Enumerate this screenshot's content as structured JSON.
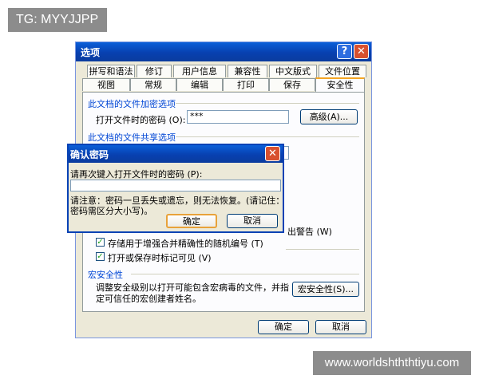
{
  "watermarks": {
    "top": "TG: MYYJJPP",
    "bottom": "www.worldshththtiyu.com"
  },
  "dialog": {
    "title": "选项",
    "help": "?",
    "close": "✕",
    "tabs_row1": [
      "拼写和语法",
      "修订",
      "用户信息",
      "兼容性",
      "中文版式",
      "文件位置"
    ],
    "tabs_row2": [
      "视图",
      "常规",
      "编辑",
      "打印",
      "保存",
      "安全性"
    ],
    "encrypt_section": "此文档的文件加密选项",
    "open_pw_label": "打开文件时的密码 (O):",
    "open_pw_value": "***",
    "advanced_button": "高级(A)...",
    "share_section": "此文档的文件共享选项",
    "warn_tail": "出警告 (W)",
    "check_random": "存储用于增强合并精确性的随机编号 (T)",
    "check_marks": "打开或保存时标记可见 (V)",
    "macro_section": "宏安全性",
    "macro_text_1": "调整安全级别以打开可能包含宏病毒的文件，并指",
    "macro_text_2": "定可信任的宏创建者姓名。",
    "macro_button": "宏安全性(S)...",
    "ok": "确定",
    "cancel": "取消"
  },
  "confirm": {
    "title": "确认密码",
    "close": "✕",
    "prompt": "请再次键入打开文件时的密码 (P):",
    "input_value": "",
    "note_1": "请注意：密码一旦丢失或遗忘，则无法恢复。(请记住：",
    "note_2": "密码需区分大小写)。",
    "ok": "确定",
    "cancel": "取消"
  },
  "colors": {
    "title_bar": "#0a5fd8",
    "close_button": "#d8502f",
    "dialog_bg": "#ece9d8"
  }
}
